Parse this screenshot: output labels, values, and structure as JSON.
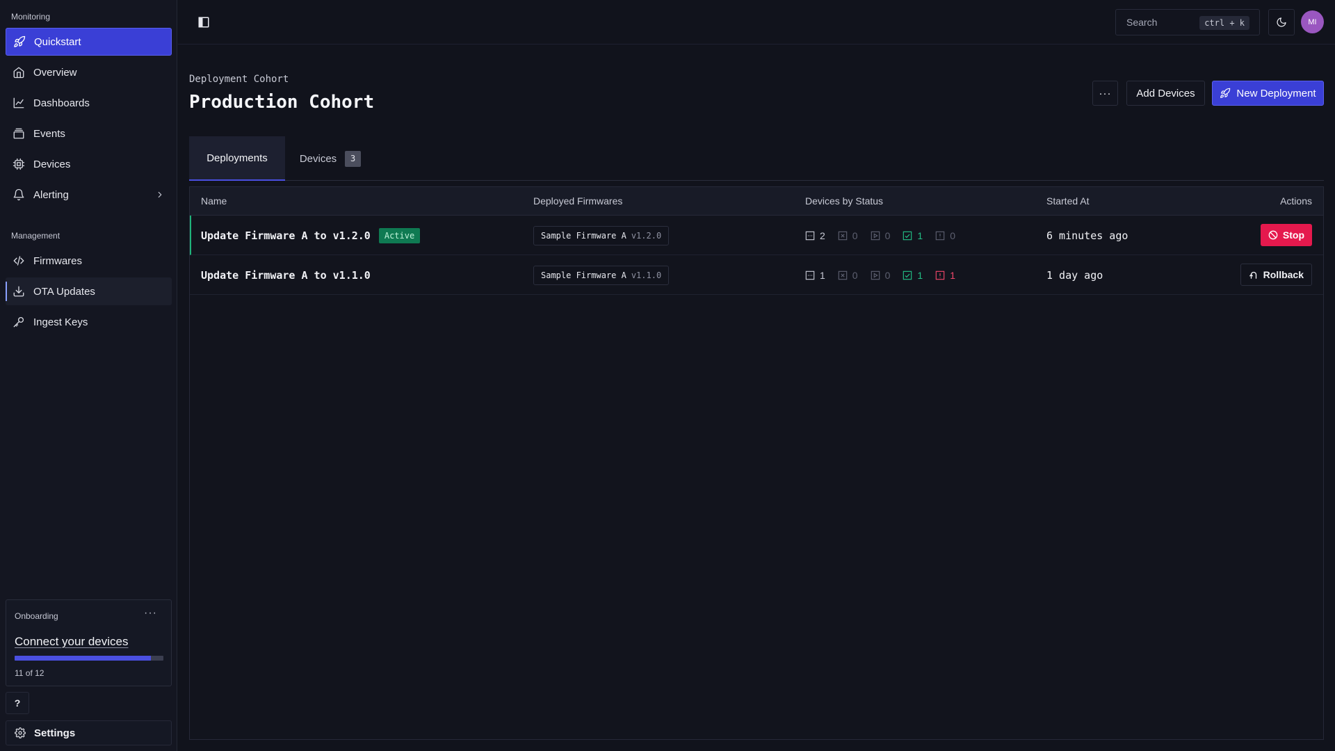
{
  "sidebar": {
    "monitoring_label": "Monitoring",
    "monitoring_items": [
      {
        "label": "Quickstart",
        "icon": "rocket-icon"
      },
      {
        "label": "Overview",
        "icon": "home-icon"
      },
      {
        "label": "Dashboards",
        "icon": "chart-line-icon"
      },
      {
        "label": "Events",
        "icon": "layers-icon"
      },
      {
        "label": "Devices",
        "icon": "cpu-icon"
      },
      {
        "label": "Alerting",
        "icon": "bell-icon"
      }
    ],
    "management_label": "Management",
    "management_items": [
      {
        "label": "Firmwares",
        "icon": "code-icon"
      },
      {
        "label": "OTA Updates",
        "icon": "download-icon"
      },
      {
        "label": "Ingest Keys",
        "icon": "key-icon"
      }
    ],
    "onboarding": {
      "title": "Onboarding",
      "link": "Connect your devices",
      "progress_label": "11 of 12",
      "progress_fraction": 0.917
    },
    "help_label": "?",
    "settings_label": "Settings"
  },
  "topbar": {
    "search_placeholder": "Search",
    "search_shortcut": "ctrl + k",
    "avatar_initials": "MI"
  },
  "header": {
    "breadcrumb": "Deployment Cohort",
    "title": "Production Cohort",
    "more_label": "···",
    "add_devices_label": "Add Devices",
    "new_deployment_label": "New Deployment"
  },
  "tabs": [
    {
      "label": "Deployments",
      "active": true
    },
    {
      "label": "Devices",
      "badge": "3",
      "active": false
    }
  ],
  "table": {
    "columns": [
      "Name",
      "Deployed Firmwares",
      "Devices by Status",
      "Started At",
      "Actions"
    ],
    "rows": [
      {
        "name": "Update Firmware A to v1.2.0",
        "status": "Active",
        "firmware_name": "Sample Firmware A",
        "firmware_version": "v1.2.0",
        "counts": {
          "pending": "2",
          "cancelled": "0",
          "in_progress": "0",
          "completed": "1",
          "failed": "0"
        },
        "started_at": "6 minutes ago",
        "action": "Stop"
      },
      {
        "name": "Update Firmware A to v1.1.0",
        "status": "",
        "firmware_name": "Sample Firmware A",
        "firmware_version": "v1.1.0",
        "counts": {
          "pending": "1",
          "cancelled": "0",
          "in_progress": "0",
          "completed": "1",
          "failed": "1"
        },
        "started_at": "1 day ago",
        "action": "Rollback"
      }
    ]
  },
  "colors": {
    "accent": "#3a3fd6",
    "success": "#22c086",
    "danger": "#e5194d",
    "active_badge": "#0f7a52"
  }
}
